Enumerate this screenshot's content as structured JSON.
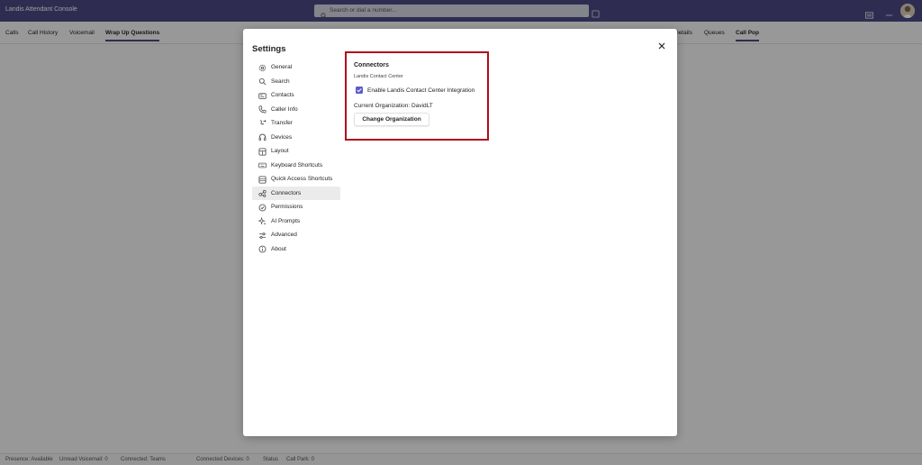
{
  "app": {
    "title": "Landis Attendant Console",
    "search_placeholder": "Search or dial a number...",
    "accent_color": "#4b4a84"
  },
  "left_tabs": [
    {
      "label": "Calls",
      "active": false
    },
    {
      "label": "Call History",
      "active": false
    },
    {
      "label": "Voicemail",
      "active": false
    },
    {
      "label": "Wrap Up Questions",
      "active": true
    }
  ],
  "right_tabs": [
    {
      "label": "Details",
      "active": false
    },
    {
      "label": "Queues",
      "active": false
    },
    {
      "label": "Call Pop",
      "active": true
    }
  ],
  "status_bar": [
    "Presence: Available",
    "Unread Voicemail: 0",
    "Connected: Teams",
    "Connected Devices: 0",
    "Status",
    "Call Park: 0"
  ],
  "settings": {
    "title": "Settings",
    "nav": [
      {
        "label": "General",
        "icon": "gear-icon"
      },
      {
        "label": "Search",
        "icon": "search-icon"
      },
      {
        "label": "Contacts",
        "icon": "contact-card-icon"
      },
      {
        "label": "Caller Info",
        "icon": "phone-icon"
      },
      {
        "label": "Transfer",
        "icon": "transfer-icon"
      },
      {
        "label": "Devices",
        "icon": "headset-icon"
      },
      {
        "label": "Layout",
        "icon": "layout-icon"
      },
      {
        "label": "Keyboard Shortcuts",
        "icon": "keyboard-icon"
      },
      {
        "label": "Quick Access Shortcuts",
        "icon": "grid-icon"
      },
      {
        "label": "Connectors",
        "icon": "connector-icon"
      },
      {
        "label": "Permissions",
        "icon": "shield-check-icon"
      },
      {
        "label": "AI Prompts",
        "icon": "sparkle-icon"
      },
      {
        "label": "Advanced",
        "icon": "sliders-icon"
      },
      {
        "label": "About",
        "icon": "info-icon"
      }
    ],
    "selected_nav": "Connectors",
    "connectors": {
      "title": "Connectors",
      "subtitle": "Landis Contact Center",
      "checkbox_label": "Enable Landis Contact Center Integration",
      "checkbox_checked": true,
      "current_org": "Current Organization: DavidLT",
      "change_button": "Change Organization"
    },
    "highlight_color": "#b00d1c",
    "checkbox_color": "#5b5fc7"
  }
}
